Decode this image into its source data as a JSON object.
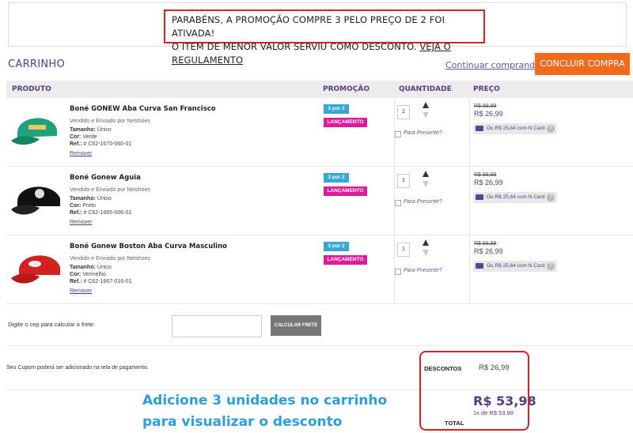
{
  "banner": {
    "line1": "PARABÉNS, A PROMOÇÃO COMPRE 3 PELO PREÇO DE 2 FOI ATIVADA!",
    "line2_prefix": "O ITEM DE MENOR VALOR SERVIU COMO DESCONTO. ",
    "rules_link": "VEJA O REGULAMENTO"
  },
  "cart": {
    "title": "CARRINHO",
    "continue_link": "Continuar comprando",
    "checkout_button": "CONCLUIR COMPRA"
  },
  "table": {
    "columns": [
      "PRODUTO",
      "PROMOÇÃO",
      "QUANTIDADE",
      "PREÇO"
    ]
  },
  "items": [
    {
      "name": "Boné GONEW Aba Curva San Francisco",
      "seller": "Vendido e Enviado por Netshoes",
      "size_label": "Tamanho:",
      "size": "Único",
      "color_label": "Cor:",
      "color": "Verde",
      "ref_label": "Ref.:",
      "ref": "# C62-1670-060-01",
      "remove": "Remover",
      "tag_promo": "3 por 2",
      "tag_new": "LANÇAMENTO",
      "qty": "1",
      "gift": "Para Presente?",
      "old_price": "R$ 99,99",
      "price": "R$ 26,99",
      "ncard": "Ou R$ 25,64 com N Card",
      "cap_color": "#1fa27a"
    },
    {
      "name": "Boné Gonew Aguia",
      "seller": "Vendido e Enviado por Netshoes",
      "size_label": "Tamanho:",
      "size": "Único",
      "color_label": "Cor:",
      "color": "Preto",
      "ref_label": "Ref.:",
      "ref": "# C62-1665-006-01",
      "remove": "Remover",
      "tag_promo": "3 por 2",
      "tag_new": "LANÇAMENTO",
      "qty": "1",
      "gift": "Para Presente?",
      "old_price": "R$ 99,99",
      "price": "R$ 26,99",
      "ncard": "Ou R$ 25,64 com N Card",
      "cap_color": "#111111"
    },
    {
      "name": "Boné Gonew Boston Aba Curva Masculino",
      "seller": "Vendido e Enviado por Netshoes",
      "size_label": "Tamanho:",
      "size": "Único",
      "color_label": "Cor:",
      "color": "Vermelho",
      "ref_label": "Ref.:",
      "ref": "# C62-1667-016-01",
      "remove": "Remover",
      "tag_promo": "3 por 2",
      "tag_new": "LANÇAMENTO",
      "qty": "1",
      "gift": "Para Presente?",
      "old_price": "R$ 99,99",
      "price": "R$ 26,99",
      "ncard": "Ou R$ 25,64 com N Card",
      "cap_color": "#d42020"
    }
  ],
  "freight": {
    "label": "Digite o cep para calcular o frete:",
    "button": "CALCULAR FRETE"
  },
  "coupon": {
    "text": "Seu Cupom poderá ser adicionado na tela de pagamento.",
    "discount_label": "DESCONTOS",
    "discount_value": "R$ 26,99"
  },
  "total": {
    "value": "R$ 53,98",
    "installment": "1x de  R$ 53,98",
    "label": "TOTAL"
  },
  "overlay": {
    "line1": "Adicione 3 unidades no carrinho",
    "line2": "para visualizar o desconto"
  },
  "colors": {
    "accent_purple": "#5a3a80",
    "checkout_orange": "#f26b1d",
    "promo_blue": "#35a8d8",
    "launch_pink": "#e01a9a",
    "highlight_red": "#e02020",
    "overlay_blue": "#2a9ee0"
  }
}
